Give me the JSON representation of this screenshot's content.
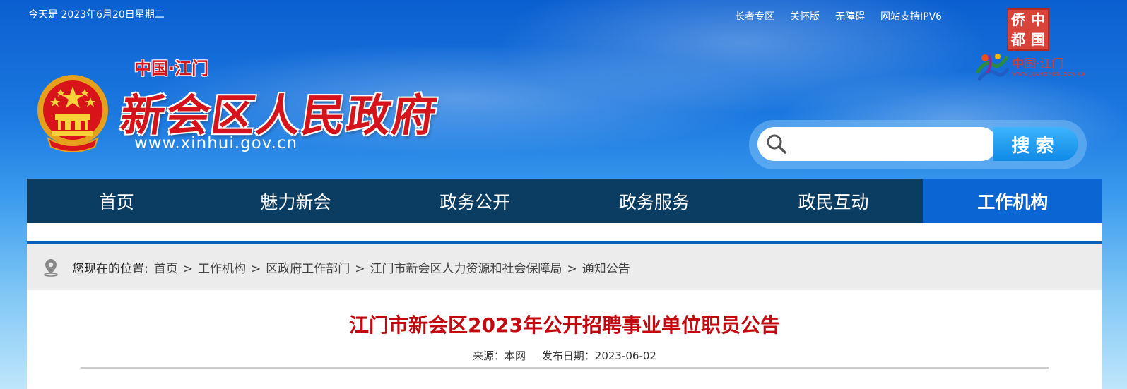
{
  "header": {
    "date_text": "今天是 2023年6月20日星期二",
    "top_links": [
      "长者专区",
      "关怀版",
      "无障碍",
      "网站支持IPV6"
    ],
    "qiao_logo_chars": [
      "侨",
      "中",
      "都",
      "国"
    ],
    "jiangmen_logo_text": "中国·江门",
    "jiangmen_logo_url": "WWW.JIANGMEN.GOV.CN",
    "sub_title": "中国·江门",
    "main_title": "新会区人民政府",
    "site_url": "www.xinhui.gov.cn",
    "search": {
      "placeholder": "",
      "value": "",
      "button_label": "搜索"
    }
  },
  "nav": {
    "items": [
      "首页",
      "魅力新会",
      "政务公开",
      "政务服务",
      "政民互动",
      "工作机构"
    ],
    "active": "工作机构"
  },
  "breadcrumb": {
    "label": "您现在的位置:",
    "items": [
      "首页",
      "工作机构",
      "区政府工作部门",
      "江门市新会区人力资源和社会保障局",
      "通知公告"
    ],
    "separator": ">"
  },
  "article": {
    "title": "江门市新会区2023年公开招聘事业单位职员公告",
    "source": "来源：本网",
    "publish_date": "发布日期：2023-06-02"
  },
  "colors": {
    "title_red": "#c1090f",
    "nav_bg": "#0b3c61",
    "nav_active": "#0b66d4"
  }
}
